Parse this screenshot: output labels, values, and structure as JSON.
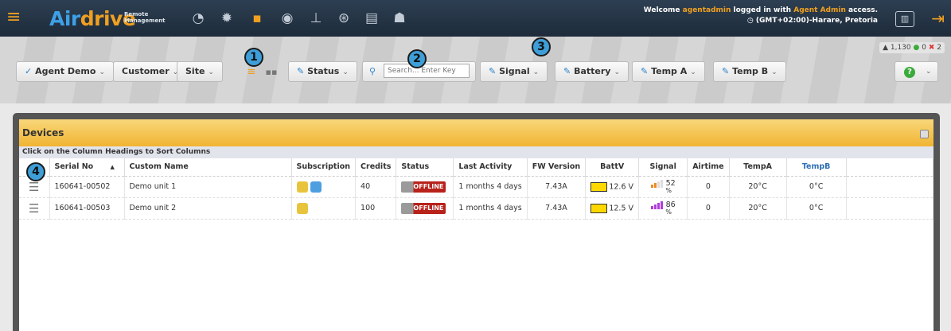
{
  "app": {
    "logo_main": "Air",
    "logo_accent": "drive",
    "logo_sub1": "Remote",
    "logo_sub2": "Management"
  },
  "header": {
    "welcome_pre": "Welcome ",
    "username": "agentadmin",
    "welcome_mid": " logged in with ",
    "access_level": "Agent Admin",
    "welcome_post": " access.",
    "timezone": "(GMT+02:00)-Harare, Pretoria",
    "nav_icons": [
      "speedometer-icon",
      "settings-gear-icon",
      "grid-icon",
      "eye-icon",
      "hierarchy-icon",
      "currency-icon",
      "document-icon",
      "users-icon"
    ]
  },
  "counts": {
    "credits": "1,130",
    "ok": "0",
    "fail": "2"
  },
  "toolbar": {
    "agent": "Agent Demo",
    "customer": "Customer",
    "site": "Site",
    "status": "Status",
    "search_placeholder": "Search... Enter Key",
    "signal": "Signal",
    "battery": "Battery",
    "temp_a": "Temp A",
    "temp_b": "Temp B"
  },
  "callouts": [
    "1",
    "2",
    "3",
    "4"
  ],
  "panel": {
    "title": "Devices",
    "hint": "Click on the Column Headings to Sort Columns"
  },
  "table": {
    "headers": [
      "Serial No",
      "Custom Name",
      "Subscription",
      "Credits",
      "Status",
      "Last Activity",
      "FW Version",
      "BattV",
      "Signal",
      "Airtime",
      "TempA",
      "TempB"
    ],
    "rows": [
      {
        "serial": "160641-00502",
        "name": "Demo unit 1",
        "credits": "40",
        "status": "OFFLINE",
        "last": "1 months 4 days",
        "fw": "7.43A",
        "batt": "12.6 V",
        "signal": "52",
        "signal_unit": "%",
        "airtime": "0",
        "temp_a": "20°C",
        "temp_b": "0°C"
      },
      {
        "serial": "160641-00503",
        "name": "Demo unit 2",
        "credits": "100",
        "status": "OFFLINE",
        "last": "1 months 4 days",
        "fw": "7.43A",
        "batt": "12.5 V",
        "signal": "86",
        "signal_unit": "%",
        "airtime": "0",
        "temp_a": "20°C",
        "temp_b": "0°C"
      }
    ]
  }
}
